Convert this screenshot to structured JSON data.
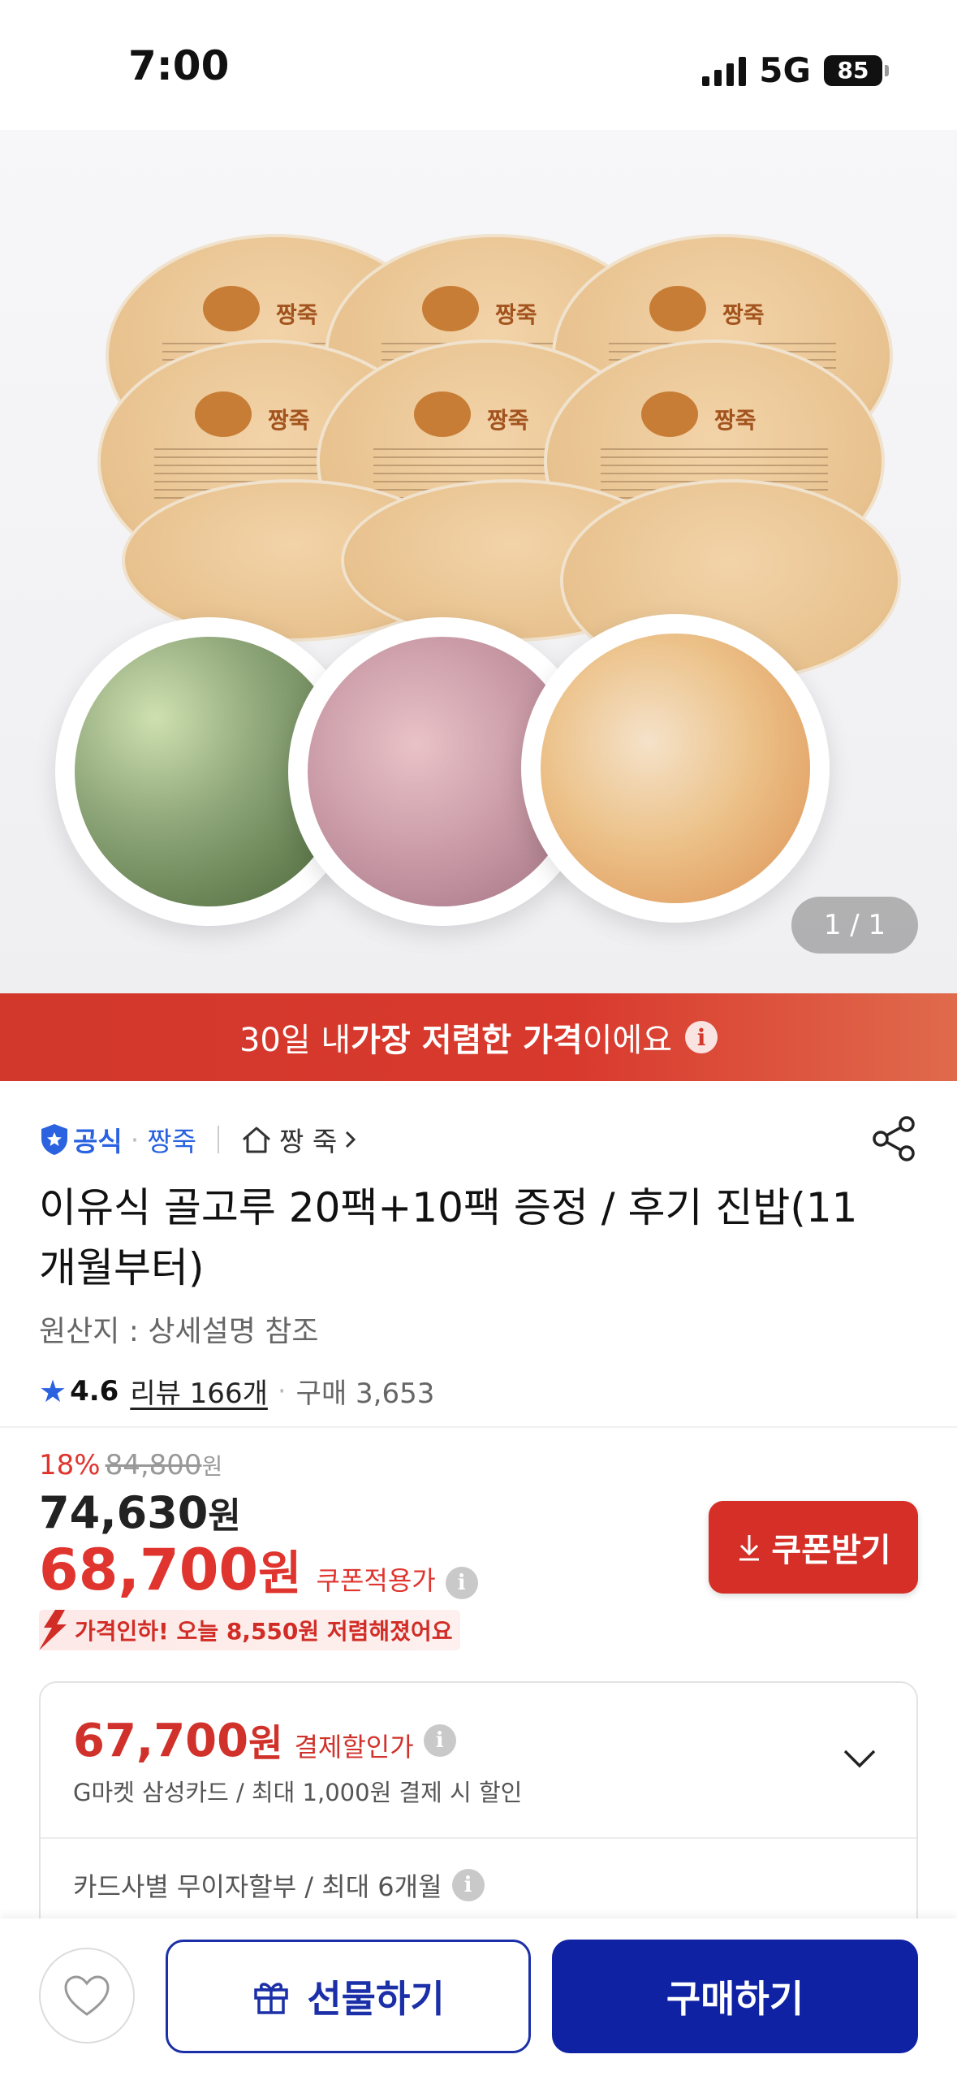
{
  "status_bar": {
    "time": "7:00",
    "network": "5G",
    "battery": "85"
  },
  "hero": {
    "pack_brand": "짱죽",
    "page_indicator": "1 / 1"
  },
  "banner": {
    "prefix": "30일 내 ",
    "highlight": "가장 저렴한 가격",
    "suffix": "이에요"
  },
  "seller": {
    "official_label": "공식",
    "brand_name": "짱죽",
    "store_name": "짱 죽",
    "icons": [
      "shield-check-icon",
      "home-icon",
      "chevron-right-icon",
      "share-icon"
    ]
  },
  "product": {
    "title": "이유식 골고루 20팩+10팩 증정 / 후기 진밥(11개월부터)",
    "origin": "원산지 : 상세설명 참조",
    "rating": "4.6",
    "review_text": "리뷰 166개",
    "purchase_text": "구매 3,653"
  },
  "price": {
    "discount_rate": "18%",
    "original_price": "84,800",
    "original_unit": "원",
    "sale_price": "74,630",
    "sale_unit": "원",
    "coupon_price": "68,700",
    "coupon_unit": "원",
    "coupon_label": "쿠폰적용가",
    "coupon_button": "쿠폰받기",
    "price_drop_text": "가격인하! 오늘 8,550원 저렴해졌어요"
  },
  "payment": {
    "price": "67,700",
    "unit": "원",
    "label": "결제할인가",
    "description": "G마켓 삼성카드 / 최대 1,000원 결제 시 할인",
    "installment": "카드사별 무이자할부 / 최대 6개월"
  },
  "bottom_bar": {
    "gift_label": "선물하기",
    "buy_label": "구매하기"
  },
  "colors": {
    "accent_red": "#d52f27",
    "accent_blue": "#0f22a4",
    "link_blue": "#2a62e0"
  }
}
